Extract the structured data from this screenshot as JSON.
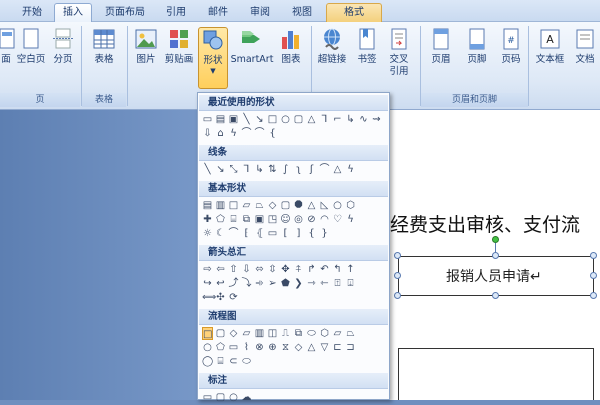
{
  "tabs": [
    {
      "label": "开始"
    },
    {
      "label": "插入"
    },
    {
      "label": "页面布局"
    },
    {
      "label": "引用"
    },
    {
      "label": "邮件"
    },
    {
      "label": "审阅"
    },
    {
      "label": "视图"
    },
    {
      "label": "格式"
    }
  ],
  "ribbon": {
    "pages_group": {
      "label": "页",
      "buttons": [
        "面",
        "空白页",
        "分页"
      ]
    },
    "table_group": {
      "label": "表格",
      "buttons": [
        "表格"
      ]
    },
    "illustrations": {
      "buttons": [
        "图片",
        "剪贴画",
        "形状",
        "SmartArt",
        "图表"
      ]
    },
    "links": {
      "buttons": [
        "超链接",
        "书签",
        "交叉",
        "引用"
      ]
    },
    "header_footer_group": {
      "label": "页眉和页脚",
      "buttons": [
        "页眉",
        "页脚",
        "页码"
      ]
    },
    "text_group": {
      "buttons": [
        "文本框",
        "文档"
      ]
    }
  },
  "dropdown": {
    "sections": [
      "最近使用的形状",
      "线条",
      "基本形状",
      "箭头总汇",
      "流程图",
      "标注"
    ]
  },
  "document": {
    "title_fragment": "经费支出审核、支付流",
    "box_text": "报销人员申请↵"
  },
  "colors": {
    "accent": "#ffcf5c",
    "tab_text": "#1e3c6e"
  }
}
